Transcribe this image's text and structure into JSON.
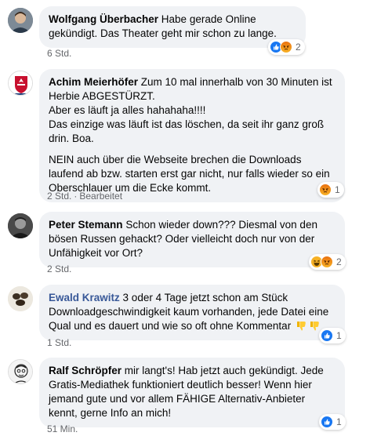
{
  "comments": [
    {
      "author": "Wolfgang Überbacher",
      "paragraphs": [
        "Habe gerade Online gekündigt. Das Theater geht mir schon zu lange."
      ],
      "time": "6 Std.",
      "edited": "",
      "reactions": [
        "like",
        "angry"
      ],
      "reaction_count": "2"
    },
    {
      "author": "Achim Meierhöfer",
      "paragraphs": [
        "Zum 10 mal innerhalb von 30 Minuten ist Herbie ABGESTÜRZT.\nAber es läuft ja alles hahahaha!!!!\nDas einzige was läuft ist das löschen, da seit ihr ganz groß drin. Boa.",
        "NEIN auch über die Webseite brechen die Downloads laufend ab bzw. starten erst gar nicht, nur falls wieder so ein Oberschlauer um die Ecke kommt."
      ],
      "time": "2 Std.",
      "edited": "Bearbeitet",
      "reactions": [
        "angry"
      ],
      "reaction_count": "1"
    },
    {
      "author": "Peter Stemann",
      "paragraphs": [
        "Schon wieder down??? Diesmal von den bösen Russen gehackt? Oder vielleicht doch nur von der Unfähigkeit vor Ort?"
      ],
      "time": "2 Std.",
      "edited": "",
      "reactions": [
        "haha",
        "angry"
      ],
      "reaction_count": "2"
    },
    {
      "author": "Ewald Krawitz",
      "paragraphs": [
        "3 oder 4 Tage jetzt schon am Stück Downloadgeschwindigkeit kaum vorhanden, jede Datei eine Qual und es dauert und wie so oft ohne Kommentar"
      ],
      "time": "1 Std.",
      "edited": "",
      "reactions": [
        "like"
      ],
      "reaction_count": "1"
    },
    {
      "author": "Ralf Schröpfer",
      "paragraphs": [
        "mir langt's! Hab jetzt auch gekündigt. Jede Gratis-Mediathek funktioniert deutlich besser! Wenn hier jemand gute und vor allem FÄHIGE Alternativ-Anbieter kennt, gerne Info an mich!"
      ],
      "time": "51 Min.",
      "edited": "",
      "reactions": [
        "like"
      ],
      "reaction_count": "1"
    }
  ],
  "emoji": {
    "thumbs_down": "thumbs-down-emoji"
  },
  "colors": {
    "bubble": "#f0f2f5",
    "link_author": "#385898",
    "meta": "#65676b",
    "like": "#1877f2"
  }
}
